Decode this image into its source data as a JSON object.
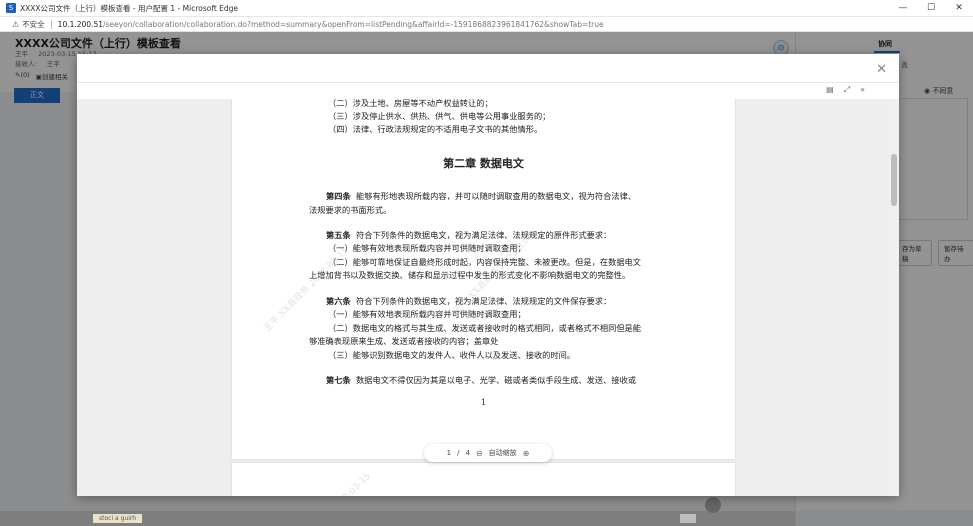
{
  "window": {
    "title": "XXXX公司文件（上行）模板查看 - 用户配置 1 - Microsoft Edge",
    "minimize": "—",
    "maximize": "☐",
    "close": "✕"
  },
  "address": {
    "security_label": "不安全",
    "url_host": "10.1.200.51",
    "url_path": "/seeyon/collaboration/collaboration.do?method=summary&openFrom=listPending&affairId=-1591868823961841762&showTab=true"
  },
  "background": {
    "doc_title": "XXXX公司文件（上行）模板查看",
    "author": "王平",
    "date": "2023-03-15 15:12",
    "receiver_label": "接收人:",
    "receiver": "王平",
    "attach_label": "(0)",
    "related_label": "创建相关",
    "tab_label": "正文",
    "right_panel_title": "协同",
    "right_row1": "盖",
    "radio_label": "不同意",
    "btn_reply": "存为草稿",
    "btn_pause": "暂存待办",
    "bottom_chip": "stoci a guirh"
  },
  "viewer": {
    "close_label": "✕",
    "tool_doc_icon": "document-icon",
    "tool_fullscreen_icon": "fullscreen-icon",
    "tool_more_icon": "double-chevron-icon",
    "page_current": "1",
    "page_sep": "/",
    "page_total": "4",
    "zoom_out": "⊖",
    "zoom_label": "自动缩放",
    "zoom_in": "⊕"
  },
  "document": {
    "lines": [
      "（二）涉及土地、房屋等不动产权益转让的；",
      "（三）涉及停止供水、供热、供气、供电等公用事业服务的；",
      "（四）法律、行政法规规定的不适用电子文书的其他情形。"
    ],
    "chapter": "第二章  数据电文",
    "art4_head": "第四条",
    "art4_l1": "能够有形地表现所载内容，并可以随时调取查用的数据电文，视为符合法律、",
    "art4_l2": "法规要求的书面形式。",
    "art5_head": "第五条",
    "art5_l1": "符合下列条件的数据电文，视为满足法律、法规规定的原件形式要求：",
    "art5_l2": "（一）能够有效地表现所载内容并可供随时调取查用；",
    "art5_l3": "（二）能够可靠地保证自最终形成时起，内容保持完整、未被更改。但是，在数据电文",
    "art5_l4": "上增加背书以及数据交换、储存和显示过程中发生的形式变化不影响数据电文的完整性。",
    "art6_head": "第六条",
    "art6_l1": "符合下列条件的数据电文，视为满足法律、法规规定的文件保存要求：",
    "art6_l2": "（一）能够有效地表现所载内容并可供随时调取查用；",
    "art6_l3": "（二）数据电文的格式与其生成、发送或者接收时的格式相同，或者格式不相同但是能",
    "art6_l4": "够准确表现原来生成、发送或者接收的内容；盖章处",
    "art6_l5": "（三）能够识别数据电文的发件人、收件人以及发送、接收的时间。",
    "art7_head": "第七条",
    "art7_l1": "数据电文不得仅因为其是以电子、光学、磁或者类似手段生成、发送、接收或",
    "page_number": "1",
    "watermark_1": "王平  XX县政务  2023-03-15",
    "watermark_2": "王平  XX县政务  2023-03-15",
    "watermark_3": "政务  2023-03-15"
  }
}
